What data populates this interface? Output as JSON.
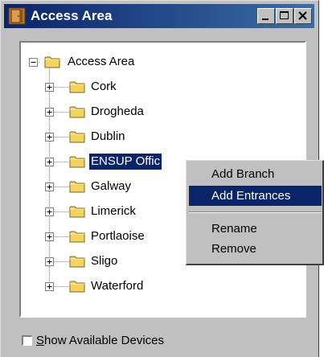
{
  "window": {
    "title": "Access Area",
    "buttons": [
      "minimize",
      "maximize",
      "close"
    ]
  },
  "tree": {
    "root": {
      "label": "Access Area",
      "icon": "folder-icon",
      "expanded": true
    },
    "children": [
      {
        "label": "Cork"
      },
      {
        "label": "Drogheda"
      },
      {
        "label": "Dublin"
      },
      {
        "label": "ENSUP Offic",
        "selected": true
      },
      {
        "label": "Galway"
      },
      {
        "label": "Limerick"
      },
      {
        "label": "Portlaoise"
      },
      {
        "label": "Sligo"
      },
      {
        "label": "Waterford"
      }
    ]
  },
  "show_devices": {
    "label": "Show Available Devices",
    "checked": false
  },
  "context_menu": {
    "items": [
      "Add Branch",
      "Add Entrances"
    ],
    "items2": [
      "Rename",
      "Remove"
    ],
    "highlighted": "Add Entrances"
  },
  "colors": {
    "titlebar_start": "#0a246a",
    "titlebar_end": "#3a6ea5",
    "folder": "#f4d35e",
    "selection": "#0a246a",
    "face": "#c0c0c0"
  }
}
